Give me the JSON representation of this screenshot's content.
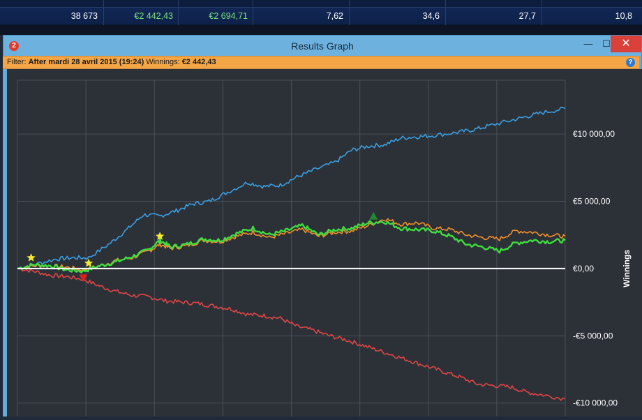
{
  "stats_row": {
    "cells": [
      "38 673",
      "€2 442,43",
      "€2 694,71",
      "7,62",
      "34,6",
      "27,7",
      "10,8"
    ]
  },
  "window": {
    "title": "Results Graph",
    "buttons": {
      "minimize": "—",
      "maximize": "☐",
      "close": "✕"
    }
  },
  "filter": {
    "filter_label": "Filter:",
    "filter_value": "After mardi 28 avril 2015 (19:24)",
    "winnings_label": "Winnings:",
    "winnings_value": "€2 442,43",
    "help": "?"
  },
  "colors": {
    "background": "#2c3138",
    "grid": "#4a5059",
    "zero_line": "#ffffff",
    "blue": "#3b9ee0",
    "green": "#3fdc3f",
    "orange": "#f0902c",
    "red": "#e04545",
    "star": "#f5e92c",
    "min_marker": "#e02020",
    "max_marker": "#1f8a2c"
  },
  "chart_data": {
    "type": "line",
    "ylabel": "Winnings",
    "ylim": [
      -11000,
      14000
    ],
    "y_ticks": [
      10000,
      5000,
      0,
      -5000,
      -10000
    ],
    "y_tick_labels": [
      "€10 000,00",
      "€5 000,00",
      "€0,00",
      "-€5 000,00",
      "-€10 000,00"
    ],
    "x_range": [
      0,
      100
    ],
    "grid": true,
    "series": [
      {
        "color": "blue",
        "x": [
          0,
          3,
          7,
          10,
          13,
          17,
          20,
          23,
          26,
          29,
          32,
          35,
          38,
          42,
          45,
          48,
          51,
          54,
          58,
          61,
          64,
          67,
          70,
          73,
          76,
          80,
          83,
          86,
          90,
          93,
          96,
          100
        ],
        "y": [
          0,
          300,
          700,
          800,
          800,
          1900,
          2900,
          4000,
          3900,
          4300,
          4800,
          5000,
          5600,
          6400,
          6100,
          6200,
          6800,
          7300,
          7900,
          8800,
          9100,
          9200,
          9700,
          9800,
          9900,
          10100,
          10300,
          10600,
          11000,
          11300,
          11600,
          11900
        ]
      },
      {
        "color": "green",
        "x": [
          0,
          3,
          6,
          9,
          12,
          15,
          18,
          21,
          24,
          26,
          28,
          31,
          34,
          37,
          40,
          43,
          46,
          49,
          52,
          55,
          58,
          61,
          64,
          67,
          70,
          73,
          76,
          79,
          82,
          85,
          88,
          91,
          94,
          97,
          100
        ],
        "y": [
          0,
          300,
          200,
          -100,
          -200,
          200,
          500,
          900,
          1400,
          2100,
          1600,
          1800,
          2200,
          2100,
          2600,
          3000,
          2500,
          2800,
          3200,
          2500,
          2900,
          3000,
          3400,
          3500,
          3000,
          2900,
          2800,
          2400,
          1800,
          1600,
          1300,
          1900,
          2100,
          2000,
          2100
        ]
      },
      {
        "color": "orange",
        "x": [
          0,
          3,
          6,
          9,
          12,
          15,
          18,
          21,
          24,
          26,
          28,
          31,
          34,
          37,
          40,
          43,
          46,
          49,
          52,
          55,
          58,
          61,
          64,
          67,
          70,
          73,
          76,
          79,
          82,
          85,
          88,
          91,
          94,
          97,
          100
        ],
        "y": [
          0,
          200,
          200,
          100,
          -100,
          200,
          600,
          800,
          1300,
          1800,
          1500,
          1700,
          2100,
          2000,
          2400,
          2700,
          2300,
          2600,
          2900,
          2400,
          2700,
          2800,
          3200,
          3700,
          3300,
          3400,
          3000,
          2900,
          2500,
          2300,
          2200,
          2800,
          2700,
          2500,
          2400
        ]
      },
      {
        "color": "red",
        "x": [
          0,
          3,
          6,
          9,
          12,
          15,
          18,
          21,
          24,
          27,
          30,
          33,
          36,
          39,
          42,
          45,
          48,
          51,
          54,
          57,
          60,
          63,
          66,
          69,
          72,
          75,
          78,
          81,
          84,
          87,
          90,
          93,
          96,
          100
        ],
        "y": [
          0,
          -200,
          -500,
          -600,
          -800,
          -1300,
          -1700,
          -2000,
          -2100,
          -2400,
          -2500,
          -2600,
          -2800,
          -3000,
          -3400,
          -3500,
          -3700,
          -4300,
          -4600,
          -5000,
          -5300,
          -5700,
          -6100,
          -6500,
          -6900,
          -7300,
          -7700,
          -8100,
          -8600,
          -8700,
          -8800,
          -9200,
          -9400,
          -9700
        ]
      }
    ],
    "markers": [
      {
        "kind": "star",
        "x": 2.5,
        "y": 800
      },
      {
        "kind": "star",
        "x": 13,
        "y": 400
      },
      {
        "kind": "star",
        "x": 26,
        "y": 2400
      },
      {
        "kind": "min",
        "x": 12,
        "y": -700
      },
      {
        "kind": "max",
        "x": 65,
        "y": 3900
      }
    ]
  }
}
